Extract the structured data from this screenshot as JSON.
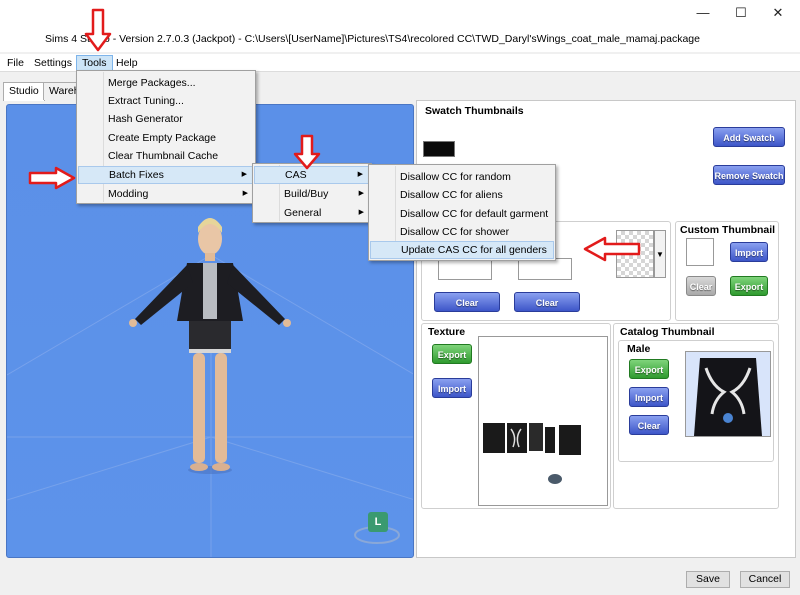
{
  "window": {
    "title": "Sims 4 Studio - Version 2.7.0.3  (Jackpot)   - C:\\Users\\[UserName]\\Pictures\\TS4\\recolored CC\\TWD_Daryl'sWings_coat_male_mamaj.package",
    "minimize": "—",
    "maximize": "☐",
    "close": "✕"
  },
  "menubar": [
    "File",
    "Settings",
    "Tools",
    "Help"
  ],
  "tabs": [
    "Studio",
    "Wareh"
  ],
  "tools_menu": [
    "Merge Packages...",
    "Extract Tuning...",
    "Hash Generator",
    "Create Empty Package",
    "Clear Thumbnail Cache",
    "Batch Fixes",
    "Modding"
  ],
  "batch_menu": [
    "CAS",
    "Build/Buy",
    "General"
  ],
  "cas_menu": [
    "Disallow CC for random",
    "Disallow CC for aliens",
    "Disallow CC for default garment",
    "Disallow CC for shower",
    "Update CAS CC for all genders"
  ],
  "swatch": {
    "title": "Swatch Thumbnails",
    "add": "Add Swatch",
    "remove": "Remove Swatch"
  },
  "clear_buttons": [
    "Clear",
    "Clear"
  ],
  "custom_thumbnail": {
    "title": "Custom Thumbnail",
    "import": "Import",
    "clear": "Clear",
    "export": "Export"
  },
  "texture": {
    "title": "Texture",
    "export": "Export",
    "import": "Import"
  },
  "catalog": {
    "title": "Catalog Thumbnail",
    "male": "Male",
    "export": "Export",
    "import": "Import",
    "clear": "Clear"
  },
  "viewport": {
    "badge": "L"
  },
  "footer": {
    "save": "Save",
    "cancel": "Cancel"
  },
  "colors": {
    "viewport_bg": "#5b90e8",
    "arrow_red": "#e21b1b",
    "menu_highlight": "#cce4f7"
  }
}
